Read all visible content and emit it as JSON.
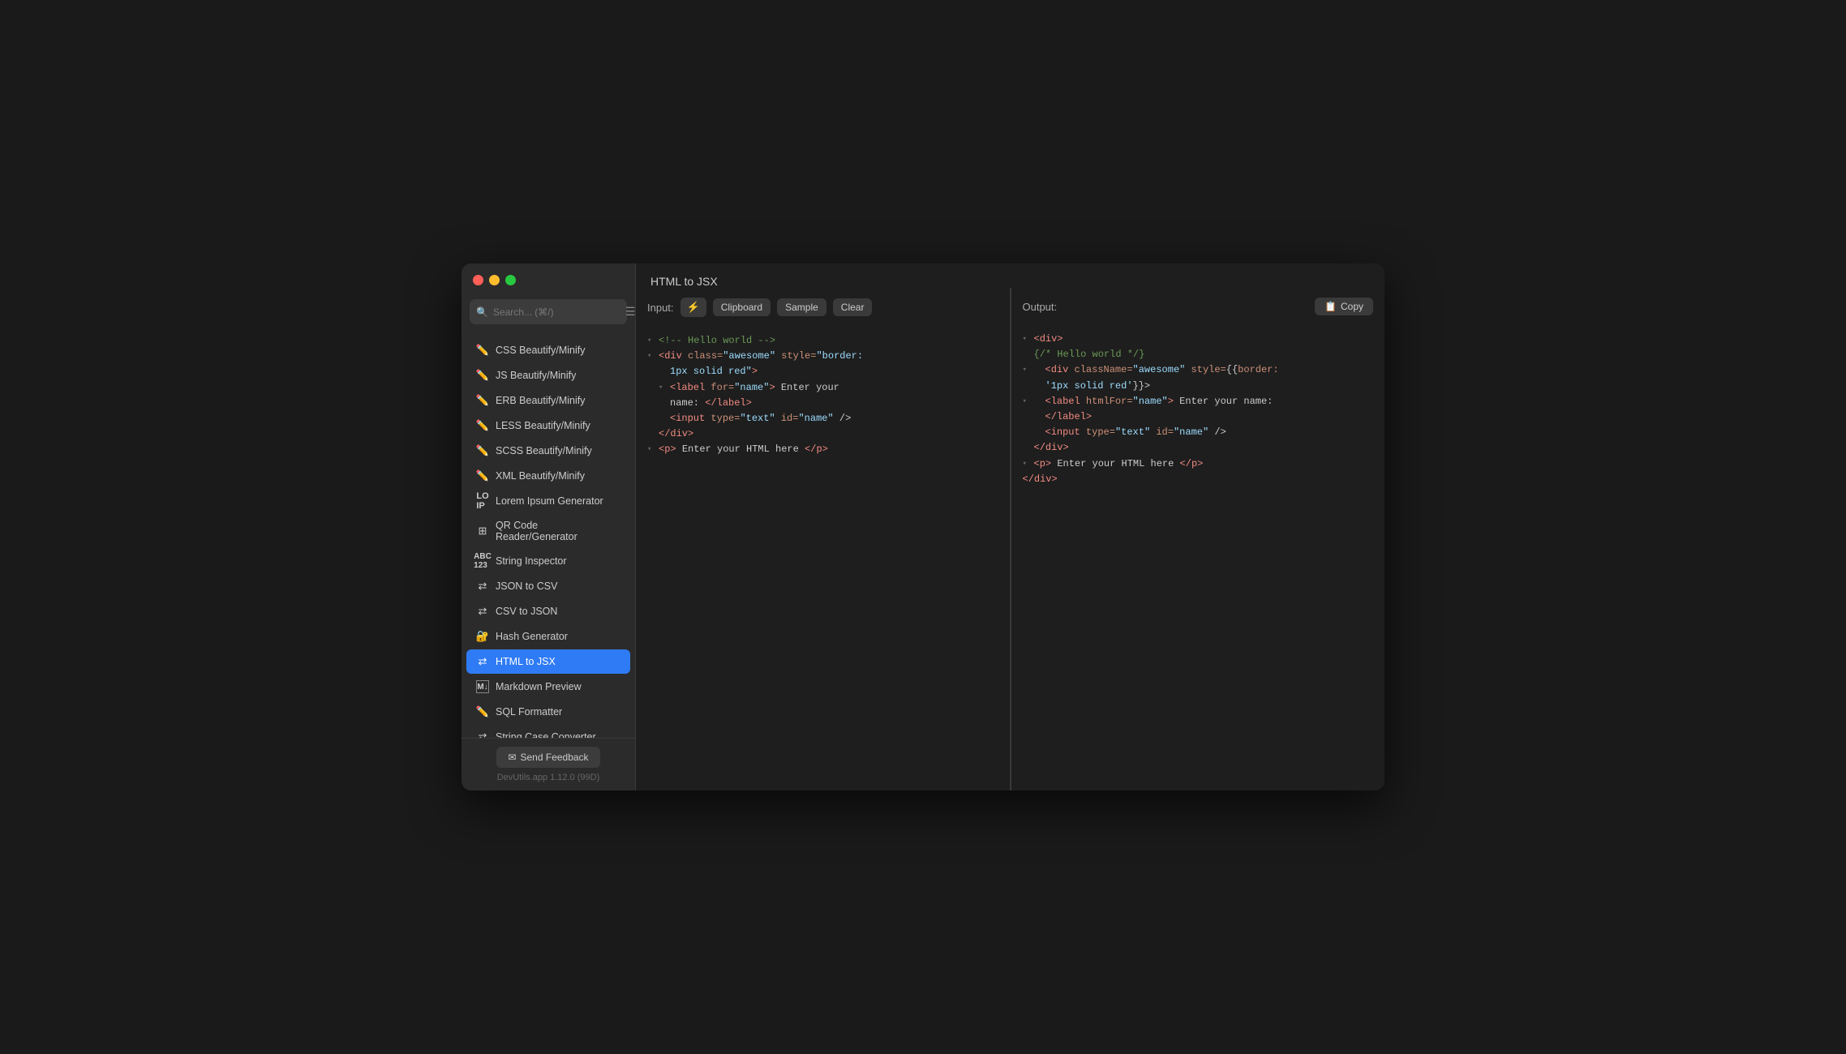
{
  "window": {
    "title": "HTML to JSX"
  },
  "sidebar": {
    "search_placeholder": "Search... (⌘/)",
    "items": [
      {
        "id": "css-beautify",
        "label": "CSS Beautify/Minify",
        "icon": "✏️"
      },
      {
        "id": "js-beautify",
        "label": "JS Beautify/Minify",
        "icon": "✏️"
      },
      {
        "id": "erb-beautify",
        "label": "ERB Beautify/Minify",
        "icon": "✏️"
      },
      {
        "id": "less-beautify",
        "label": "LESS Beautify/Minify",
        "icon": "✏️"
      },
      {
        "id": "scss-beautify",
        "label": "SCSS Beautify/Minify",
        "icon": "✏️"
      },
      {
        "id": "xml-beautify",
        "label": "XML Beautify/Minify",
        "icon": "✏️"
      },
      {
        "id": "lorem-ipsum",
        "label": "Lorem Ipsum Generator",
        "icon": "🔤"
      },
      {
        "id": "qr-code",
        "label": "QR Code Reader/Generator",
        "icon": "⬛"
      },
      {
        "id": "string-inspector",
        "label": "String Inspector",
        "icon": "🔤"
      },
      {
        "id": "json-to-csv",
        "label": "JSON to CSV",
        "icon": "🔄"
      },
      {
        "id": "csv-to-json",
        "label": "CSV to JSON",
        "icon": "🔄"
      },
      {
        "id": "hash-generator",
        "label": "Hash Generator",
        "icon": "🔐"
      },
      {
        "id": "html-to-jsx",
        "label": "HTML to JSX",
        "icon": "🔄",
        "active": true
      },
      {
        "id": "markdown-preview",
        "label": "Markdown Preview",
        "icon": "M+"
      },
      {
        "id": "sql-formatter",
        "label": "SQL Formatter",
        "icon": "✏️"
      },
      {
        "id": "string-case",
        "label": "String Case Converter",
        "icon": "🔄"
      }
    ],
    "feedback_btn": "Send Feedback",
    "version": "DevUtils.app 1.12.0 (99D)"
  },
  "input_panel": {
    "label": "Input:",
    "buttons": {
      "lightning": "⚡",
      "clipboard": "Clipboard",
      "sample": "Sample",
      "clear": "Clear"
    }
  },
  "output_panel": {
    "label": "Output:",
    "copy_btn": "Copy"
  }
}
